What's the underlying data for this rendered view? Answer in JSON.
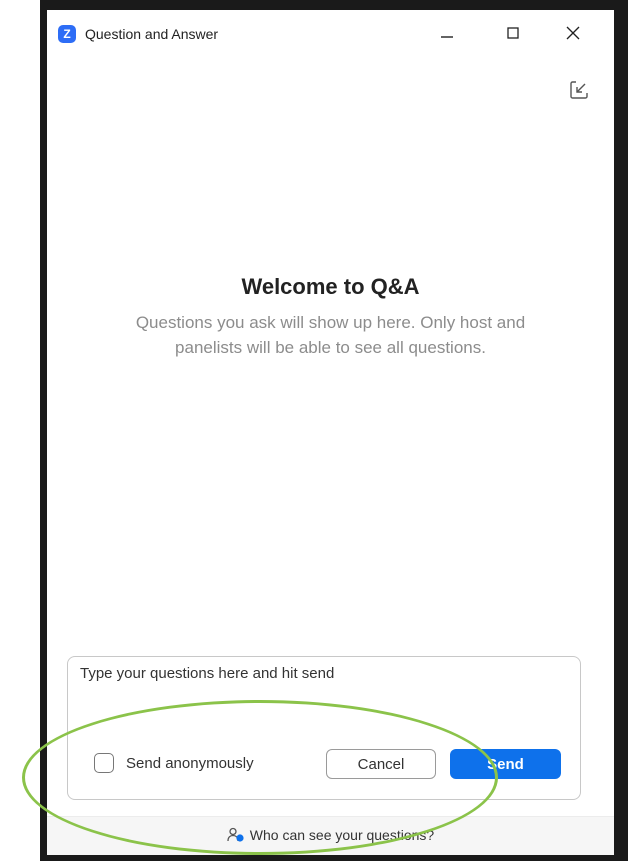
{
  "window": {
    "title": "Question and Answer",
    "app_icon_letter": "Z"
  },
  "welcome": {
    "title": "Welcome to Q&A",
    "subtitle": "Questions you ask will show up here. Only host and panelists will be able to see all questions."
  },
  "compose": {
    "placeholder": "Type your questions here and hit send",
    "value": "",
    "anonymous_label": "Send anonymously",
    "anonymous_checked": false,
    "cancel_label": "Cancel",
    "send_label": "Send"
  },
  "footer": {
    "link_text": "Who can see your questions?"
  },
  "icons": {
    "app": "zoom-logo-icon",
    "minimize": "minimize-icon",
    "maximize": "maximize-icon",
    "close": "close-icon",
    "popout": "pop-in-icon",
    "people": "people-icon"
  },
  "colors": {
    "accent": "#0e71eb",
    "app_icon": "#2d6df6",
    "highlight": "#8bc34a",
    "subtitle_text": "#8c8c8c"
  }
}
